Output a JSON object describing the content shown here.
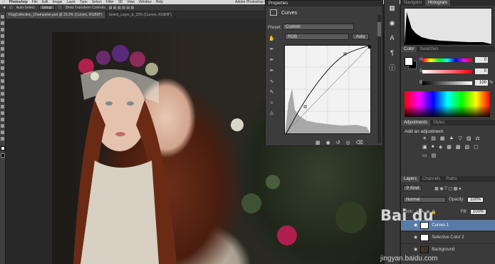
{
  "menubar": {
    "app": "Photoshop",
    "items": [
      "File",
      "Edit",
      "Image",
      "Layer",
      "Type",
      "Select",
      "Filter",
      "3D",
      "View",
      "Window",
      "Help"
    ],
    "app_title": "Adobe Photoshop CC 2014"
  },
  "options_bar": {
    "auto_select_label": "Auto-Select:",
    "auto_select_value": "Group",
    "show_transform": "Show Transform Controls"
  },
  "doc_tabs": [
    {
      "label": "FlagCollection_Champelier.psd @ 33.3% (Curves, RGB/8*)",
      "active": true
    },
    {
      "label": "Select_Layer_&_33% (Curves, RGB/8*)",
      "active": false
    }
  ],
  "properties": {
    "panel_title": "Properties",
    "title": "Curves",
    "preset_label": "Preset:",
    "preset_value": "Custom",
    "channel_value": "RGB",
    "auto_label": "Auto",
    "tool_icons": [
      "hand-icon",
      "eyedropper-black-icon",
      "eyedropper-gray-icon",
      "eyedropper-white-icon",
      "curve-point-icon",
      "pencil-icon",
      "smooth-icon",
      "warning-icon"
    ],
    "bottom_icons": [
      "clip-icon",
      "eye-preview-icon",
      "reset-icon",
      "visibility-icon",
      "trash-icon"
    ]
  },
  "navigator": {
    "tabs": [
      {
        "label": "Navigator",
        "active": false
      },
      {
        "label": "Histogram",
        "active": true
      }
    ]
  },
  "color": {
    "tabs": [
      {
        "label": "Color",
        "active": true
      },
      {
        "label": "Swatches",
        "active": false
      }
    ],
    "sliders": [
      {
        "label": "H",
        "value": "0"
      },
      {
        "label": "S",
        "value": "0"
      },
      {
        "label": "B",
        "value": "100"
      }
    ],
    "unit": "%"
  },
  "adjustments": {
    "tabs": [
      {
        "label": "Adjustments",
        "active": true
      },
      {
        "label": "Styles",
        "active": false
      }
    ],
    "add_label": "Add an adjustment"
  },
  "layers": {
    "tabs": [
      {
        "label": "Layers",
        "active": true
      },
      {
        "label": "Channels",
        "active": false
      },
      {
        "label": "Paths",
        "active": false
      }
    ],
    "kind_label": "Kind",
    "blend_mode": "Normal",
    "opacity_label": "Opacity:",
    "opacity_value": "100%",
    "lock_label": "Lock:",
    "fill_label": "Fill:",
    "fill_value": "100%",
    "list": [
      {
        "name": "Curves 1",
        "selected": true
      },
      {
        "name": "Selective Color 2",
        "selected": false
      },
      {
        "name": "Background",
        "selected": false
      }
    ]
  },
  "watermark": {
    "logo": "Bai du",
    "url": "jingyan.baidu.com"
  }
}
